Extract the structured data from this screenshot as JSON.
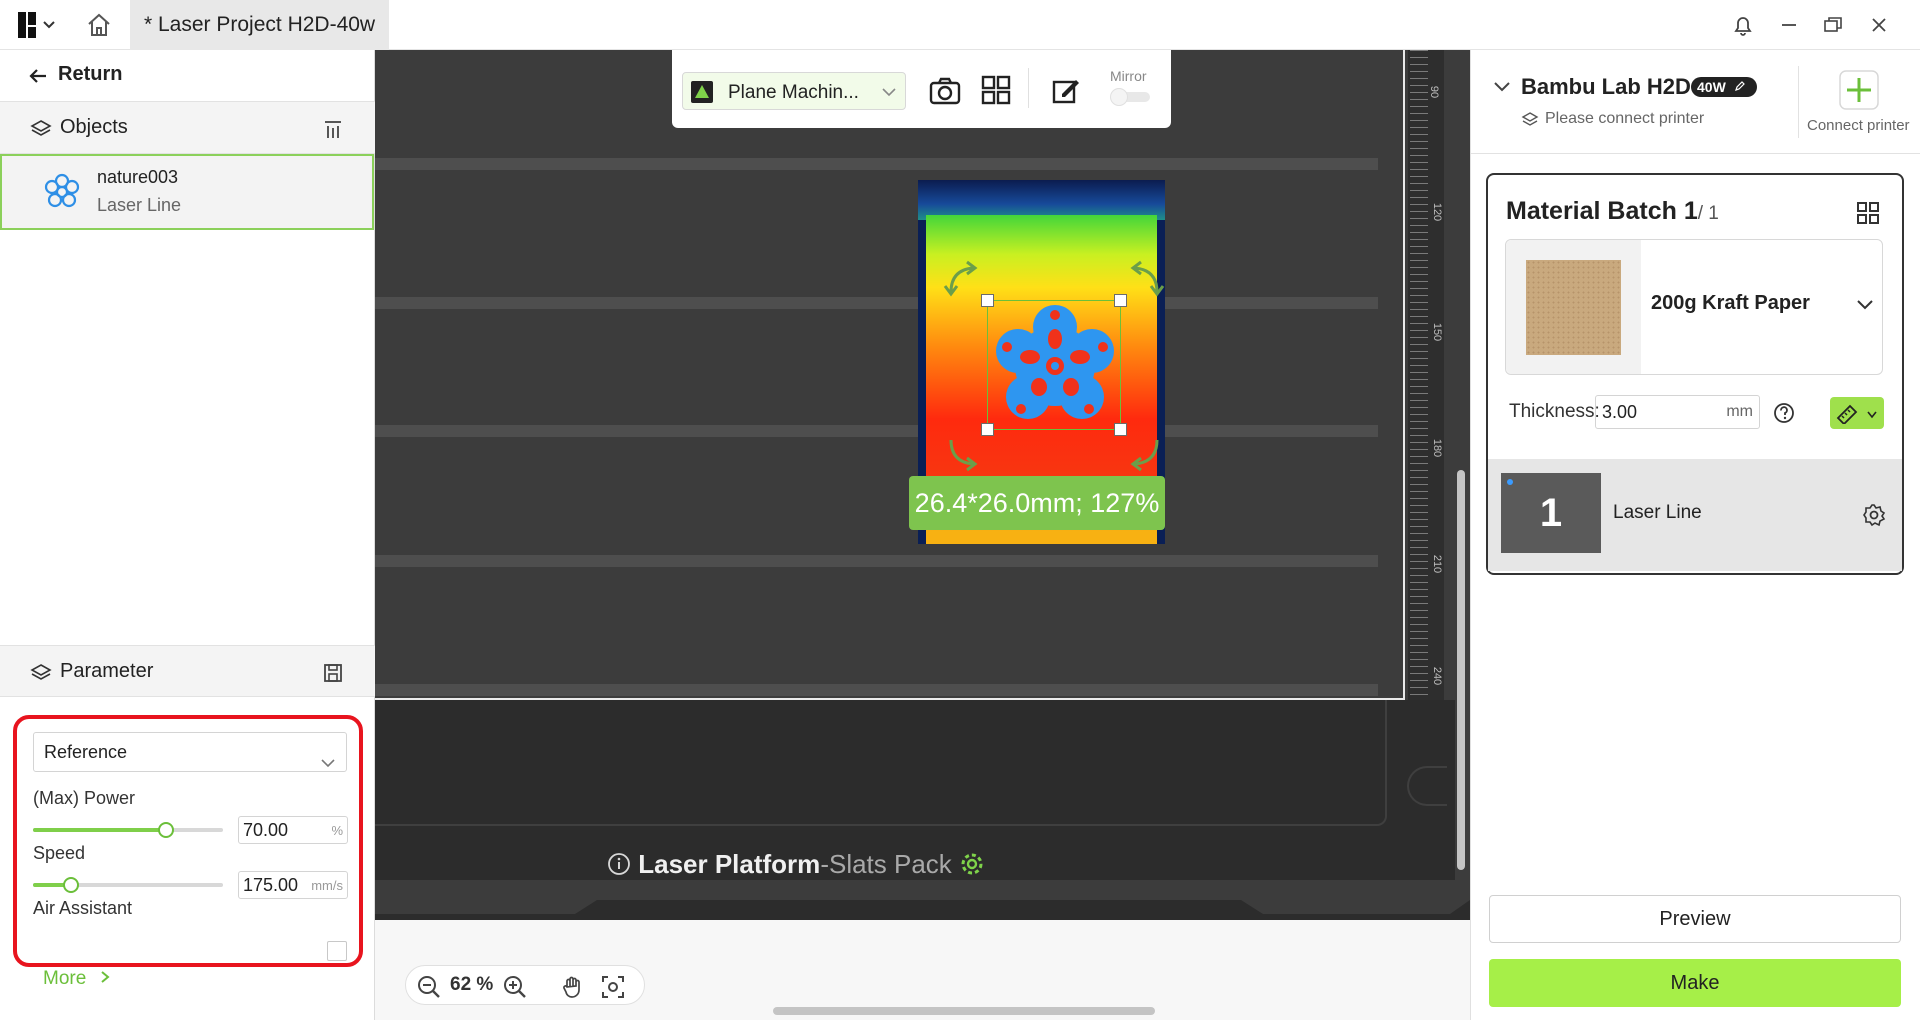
{
  "titlebar": {
    "doc_title": "* Laser Project H2D-40w"
  },
  "left": {
    "return_label": "Return",
    "objects_label": "Objects",
    "object": {
      "name": "nature003",
      "type": "Laser Line"
    },
    "parameter_label": "Parameter",
    "preset": "Reference",
    "power": {
      "label": "(Max) Power",
      "value": "70.00",
      "unit": "%",
      "level": 0.7
    },
    "speed": {
      "label": "Speed",
      "value": "175.00",
      "unit": "mm/s",
      "level": 0.2
    },
    "air_assistant_label": "Air Assistant",
    "more_label": "More"
  },
  "toolbar": {
    "machine": "Plane Machin...",
    "mirror_label": "Mirror"
  },
  "canvas": {
    "dimension_label": "26.4*26.0mm; 127%",
    "platform_bold": "Laser Platform",
    "platform_light": "-Slats Pack",
    "zoom": "62 %",
    "ruler_labels": [
      "90",
      "120",
      "150",
      "180",
      "210",
      "240"
    ]
  },
  "right": {
    "printer_name": "Bambu Lab H2D",
    "printer_badge": "40W",
    "connect_hint": "Please connect printer",
    "connect_button": "Connect printer",
    "batch_title": "Material Batch 1",
    "batch_count": "/ 1",
    "material_name": "200g Kraft Paper",
    "thickness_label": "Thickness:",
    "thickness_value": "3.00",
    "thickness_unit": "mm",
    "layer_number": "1",
    "layer_name": "Laser Line",
    "preview_label": "Preview",
    "make_label": "Make"
  },
  "colors": {
    "accent_green": "#a6ef48",
    "highlight_red": "#e8141e",
    "canvas_bg": "#3c3c3c"
  }
}
